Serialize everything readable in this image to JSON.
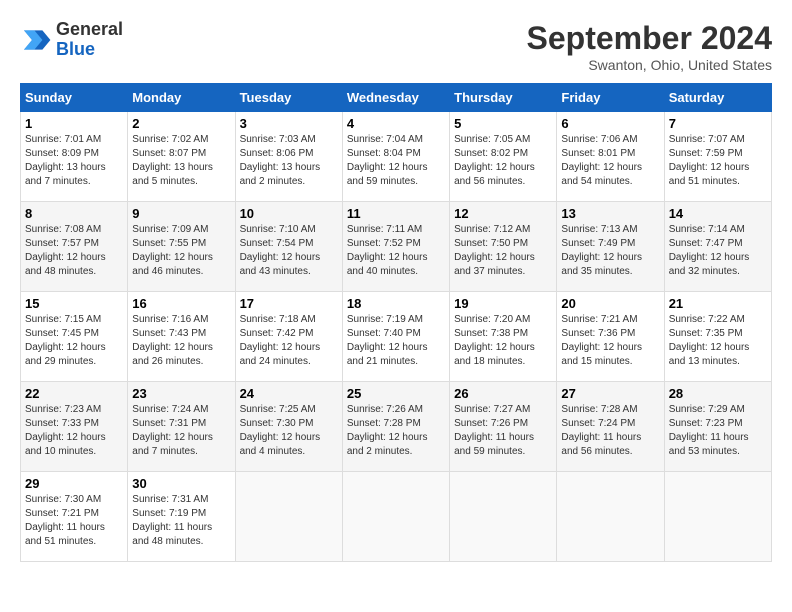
{
  "logo": {
    "line1": "General",
    "line2": "Blue"
  },
  "title": "September 2024",
  "location": "Swanton, Ohio, United States",
  "days_of_week": [
    "Sunday",
    "Monday",
    "Tuesday",
    "Wednesday",
    "Thursday",
    "Friday",
    "Saturday"
  ],
  "weeks": [
    [
      {
        "day": 1,
        "info": "Sunrise: 7:01 AM\nSunset: 8:09 PM\nDaylight: 13 hours\nand 7 minutes."
      },
      {
        "day": 2,
        "info": "Sunrise: 7:02 AM\nSunset: 8:07 PM\nDaylight: 13 hours\nand 5 minutes."
      },
      {
        "day": 3,
        "info": "Sunrise: 7:03 AM\nSunset: 8:06 PM\nDaylight: 13 hours\nand 2 minutes."
      },
      {
        "day": 4,
        "info": "Sunrise: 7:04 AM\nSunset: 8:04 PM\nDaylight: 12 hours\nand 59 minutes."
      },
      {
        "day": 5,
        "info": "Sunrise: 7:05 AM\nSunset: 8:02 PM\nDaylight: 12 hours\nand 56 minutes."
      },
      {
        "day": 6,
        "info": "Sunrise: 7:06 AM\nSunset: 8:01 PM\nDaylight: 12 hours\nand 54 minutes."
      },
      {
        "day": 7,
        "info": "Sunrise: 7:07 AM\nSunset: 7:59 PM\nDaylight: 12 hours\nand 51 minutes."
      }
    ],
    [
      {
        "day": 8,
        "info": "Sunrise: 7:08 AM\nSunset: 7:57 PM\nDaylight: 12 hours\nand 48 minutes."
      },
      {
        "day": 9,
        "info": "Sunrise: 7:09 AM\nSunset: 7:55 PM\nDaylight: 12 hours\nand 46 minutes."
      },
      {
        "day": 10,
        "info": "Sunrise: 7:10 AM\nSunset: 7:54 PM\nDaylight: 12 hours\nand 43 minutes."
      },
      {
        "day": 11,
        "info": "Sunrise: 7:11 AM\nSunset: 7:52 PM\nDaylight: 12 hours\nand 40 minutes."
      },
      {
        "day": 12,
        "info": "Sunrise: 7:12 AM\nSunset: 7:50 PM\nDaylight: 12 hours\nand 37 minutes."
      },
      {
        "day": 13,
        "info": "Sunrise: 7:13 AM\nSunset: 7:49 PM\nDaylight: 12 hours\nand 35 minutes."
      },
      {
        "day": 14,
        "info": "Sunrise: 7:14 AM\nSunset: 7:47 PM\nDaylight: 12 hours\nand 32 minutes."
      }
    ],
    [
      {
        "day": 15,
        "info": "Sunrise: 7:15 AM\nSunset: 7:45 PM\nDaylight: 12 hours\nand 29 minutes."
      },
      {
        "day": 16,
        "info": "Sunrise: 7:16 AM\nSunset: 7:43 PM\nDaylight: 12 hours\nand 26 minutes."
      },
      {
        "day": 17,
        "info": "Sunrise: 7:18 AM\nSunset: 7:42 PM\nDaylight: 12 hours\nand 24 minutes."
      },
      {
        "day": 18,
        "info": "Sunrise: 7:19 AM\nSunset: 7:40 PM\nDaylight: 12 hours\nand 21 minutes."
      },
      {
        "day": 19,
        "info": "Sunrise: 7:20 AM\nSunset: 7:38 PM\nDaylight: 12 hours\nand 18 minutes."
      },
      {
        "day": 20,
        "info": "Sunrise: 7:21 AM\nSunset: 7:36 PM\nDaylight: 12 hours\nand 15 minutes."
      },
      {
        "day": 21,
        "info": "Sunrise: 7:22 AM\nSunset: 7:35 PM\nDaylight: 12 hours\nand 13 minutes."
      }
    ],
    [
      {
        "day": 22,
        "info": "Sunrise: 7:23 AM\nSunset: 7:33 PM\nDaylight: 12 hours\nand 10 minutes."
      },
      {
        "day": 23,
        "info": "Sunrise: 7:24 AM\nSunset: 7:31 PM\nDaylight: 12 hours\nand 7 minutes."
      },
      {
        "day": 24,
        "info": "Sunrise: 7:25 AM\nSunset: 7:30 PM\nDaylight: 12 hours\nand 4 minutes."
      },
      {
        "day": 25,
        "info": "Sunrise: 7:26 AM\nSunset: 7:28 PM\nDaylight: 12 hours\nand 2 minutes."
      },
      {
        "day": 26,
        "info": "Sunrise: 7:27 AM\nSunset: 7:26 PM\nDaylight: 11 hours\nand 59 minutes."
      },
      {
        "day": 27,
        "info": "Sunrise: 7:28 AM\nSunset: 7:24 PM\nDaylight: 11 hours\nand 56 minutes."
      },
      {
        "day": 28,
        "info": "Sunrise: 7:29 AM\nSunset: 7:23 PM\nDaylight: 11 hours\nand 53 minutes."
      }
    ],
    [
      {
        "day": 29,
        "info": "Sunrise: 7:30 AM\nSunset: 7:21 PM\nDaylight: 11 hours\nand 51 minutes."
      },
      {
        "day": 30,
        "info": "Sunrise: 7:31 AM\nSunset: 7:19 PM\nDaylight: 11 hours\nand 48 minutes."
      },
      null,
      null,
      null,
      null,
      null
    ]
  ]
}
